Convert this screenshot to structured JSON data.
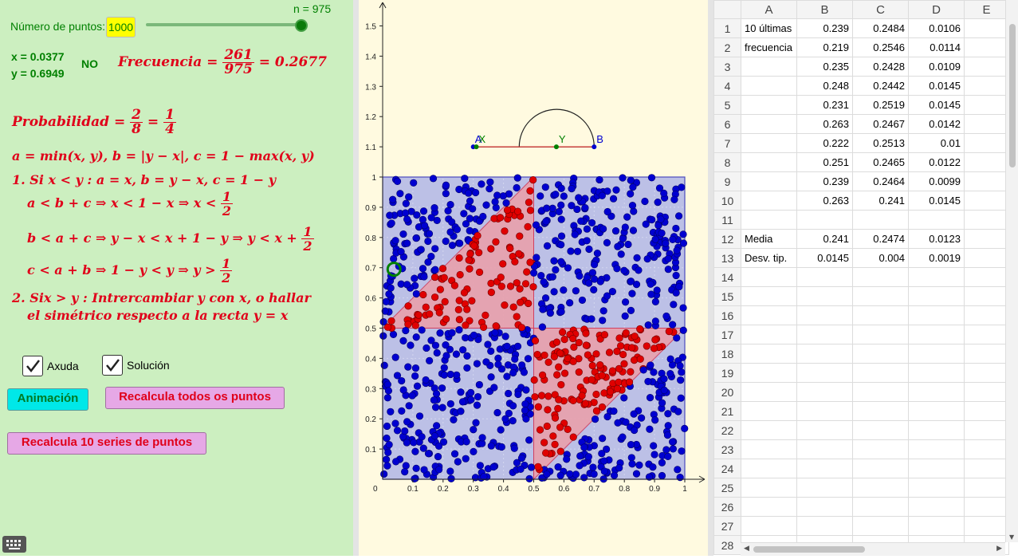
{
  "left_panel": {
    "n_label": "n = 975",
    "num_puntos_label": "Número de puntos:",
    "num_puntos_value": "1000",
    "slider_fraction": 0.975,
    "x_value": "x = 0.0377",
    "y_value": "y = 0.6949",
    "result": "NO",
    "frecuencia_label": "Frecuencia =",
    "frecuencia_num": "261",
    "frecuencia_den": "975",
    "frecuencia_result": "= 0.2677",
    "probabilidad_label": "Probabilidad =",
    "prob_num1": "2",
    "prob_den1": "8",
    "prob_eq": "=",
    "prob_num2": "1",
    "prob_den2": "4",
    "line_abc": "a = min(x, y),  b = |y − x|,  c = 1 − max(x, y)",
    "case1": "1. Si x < y : a = x,  b = y − x,  c = 1 − y",
    "ineq1": "a < b + c ⇒ x < 1 − x ⇒ x <",
    "ineq2": "b < a + c ⇒ y − x < x + 1 − y ⇒ y < x +",
    "ineq3": "c < a + b ⇒ 1 − y < y ⇒ y >",
    "half_num": "1",
    "half_den": "2",
    "case2_line1": "2. Six > y :  Intrercambiar y con x,  o hallar",
    "case2_line2": "el simétrico respecto a la recta y = x",
    "checkbox_axuda": "Axuda",
    "checkbox_solucion": "Solución",
    "btn_animacion": "Animación",
    "btn_recalcula_todos": "Recalcula todos os puntos",
    "btn_recalcula_10": "Recalcula 10 series de puntos"
  },
  "graph": {
    "y_ticks": [
      "0.1",
      "0.2",
      "0.3",
      "0.4",
      "0.5",
      "0.6",
      "0.7",
      "0.8",
      "0.9",
      "1",
      "1.1",
      "1.2",
      "1.3",
      "1.4",
      "1.5"
    ],
    "x_ticks": [
      "0.1",
      "0.2",
      "0.3",
      "0.4",
      "0.5",
      "0.6",
      "0.7",
      "0.8",
      "0.9",
      "1"
    ],
    "origin_label": "0",
    "point_A": "A",
    "point_X": "X",
    "point_Y": "Y",
    "point_B": "B",
    "segment": {
      "A": 0.3,
      "X": 0.31,
      "Y": 0.575,
      "B": 0.7
    },
    "highlight_point": {
      "x": 0.0377,
      "y": 0.6949
    },
    "inside_count": 261,
    "total_count": 975,
    "colors": {
      "inside": "#e00000",
      "outside": "#0000d0",
      "square_fill": "#bcc0e6",
      "triangle_fill": "#e9a0ac",
      "highlight": "#008000"
    }
  },
  "spreadsheet": {
    "columns": [
      "A",
      "B",
      "C",
      "D",
      "E"
    ],
    "rows": [
      {
        "n": "1",
        "A": "10 últimas",
        "B": "0.239",
        "C": "0.2484",
        "D": "0.0106"
      },
      {
        "n": "2",
        "A": "frecuencia",
        "B": "0.219",
        "C": "0.2546",
        "D": "0.0114"
      },
      {
        "n": "3",
        "A": "",
        "B": "0.235",
        "C": "0.2428",
        "D": "0.0109"
      },
      {
        "n": "4",
        "A": "",
        "B": "0.248",
        "C": "0.2442",
        "D": "0.0145"
      },
      {
        "n": "5",
        "A": "",
        "B": "0.231",
        "C": "0.2519",
        "D": "0.0145"
      },
      {
        "n": "6",
        "A": "",
        "B": "0.263",
        "C": "0.2467",
        "D": "0.0142"
      },
      {
        "n": "7",
        "A": "",
        "B": "0.222",
        "C": "0.2513",
        "D": "0.01"
      },
      {
        "n": "8",
        "A": "",
        "B": "0.251",
        "C": "0.2465",
        "D": "0.0122"
      },
      {
        "n": "9",
        "A": "",
        "B": "0.239",
        "C": "0.2464",
        "D": "0.0099"
      },
      {
        "n": "10",
        "A": "",
        "B": "0.263",
        "C": "0.241",
        "D": "0.0145"
      },
      {
        "n": "11",
        "A": "",
        "B": "",
        "C": "",
        "D": ""
      },
      {
        "n": "12",
        "A": "Media",
        "B": "0.241",
        "C": "0.2474",
        "D": "0.0123"
      },
      {
        "n": "13",
        "A": "Desv. tip.",
        "B": "0.0145",
        "C": "0.004",
        "D": "0.0019"
      },
      {
        "n": "14",
        "A": "",
        "B": "",
        "C": "",
        "D": ""
      },
      {
        "n": "15",
        "A": "",
        "B": "",
        "C": "",
        "D": ""
      },
      {
        "n": "16",
        "A": "",
        "B": "",
        "C": "",
        "D": ""
      },
      {
        "n": "17",
        "A": "",
        "B": "",
        "C": "",
        "D": ""
      },
      {
        "n": "18",
        "A": "",
        "B": "",
        "C": "",
        "D": ""
      },
      {
        "n": "19",
        "A": "",
        "B": "",
        "C": "",
        "D": ""
      },
      {
        "n": "20",
        "A": "",
        "B": "",
        "C": "",
        "D": ""
      },
      {
        "n": "21",
        "A": "",
        "B": "",
        "C": "",
        "D": ""
      },
      {
        "n": "22",
        "A": "",
        "B": "",
        "C": "",
        "D": ""
      },
      {
        "n": "23",
        "A": "",
        "B": "",
        "C": "",
        "D": ""
      },
      {
        "n": "24",
        "A": "",
        "B": "",
        "C": "",
        "D": ""
      },
      {
        "n": "25",
        "A": "",
        "B": "",
        "C": "",
        "D": ""
      },
      {
        "n": "26",
        "A": "",
        "B": "",
        "C": "",
        "D": ""
      },
      {
        "n": "27",
        "A": "",
        "B": "",
        "C": "",
        "D": ""
      },
      {
        "n": "28",
        "A": "",
        "B": "",
        "C": "",
        "D": ""
      }
    ]
  }
}
